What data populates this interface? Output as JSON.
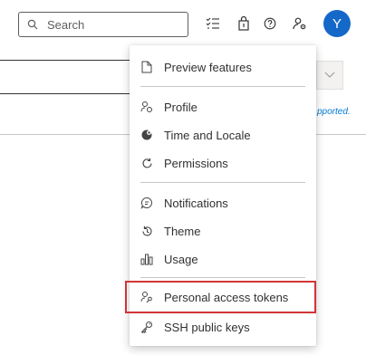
{
  "header": {
    "search_placeholder": "Search",
    "avatar_initial": "Y"
  },
  "background": {
    "note_text": "pported."
  },
  "menu": {
    "items": [
      {
        "label": "Preview features",
        "icon": "document-icon"
      },
      {
        "label": "Profile",
        "icon": "profile-icon"
      },
      {
        "label": "Time and Locale",
        "icon": "globe-icon"
      },
      {
        "label": "Permissions",
        "icon": "refresh-icon"
      },
      {
        "label": "Notifications",
        "icon": "chat-bubble-icon"
      },
      {
        "label": "Theme",
        "icon": "history-icon"
      },
      {
        "label": "Usage",
        "icon": "bar-chart-icon"
      },
      {
        "label": "Personal access tokens",
        "icon": "key-person-icon"
      },
      {
        "label": "SSH public keys",
        "icon": "key-icon"
      }
    ],
    "highlighted_item": "Personal access tokens",
    "highlight_color": "#d13438"
  },
  "colors": {
    "avatar_bg": "#1468c8",
    "link": "#0078d4"
  }
}
